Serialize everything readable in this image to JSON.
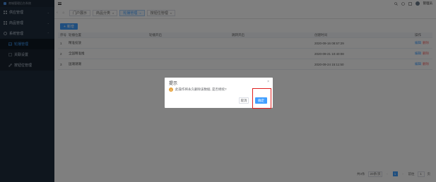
{
  "brand": {
    "name": "商城管理后台系统"
  },
  "sidebar": {
    "items": [
      {
        "label": "供应管理",
        "icon": "grid-icon"
      },
      {
        "label": "商品管理",
        "icon": "grid-icon"
      },
      {
        "label": "系统管理",
        "icon": "gear-icon"
      }
    ],
    "subitems": [
      {
        "label": "轮播管理",
        "icon": "image-icon"
      },
      {
        "label": "关联设置",
        "icon": "doc-icon"
      },
      {
        "label": "按钮位管理",
        "icon": "link-icon"
      }
    ]
  },
  "topbar": {
    "user": "管理员"
  },
  "tabs": {
    "items": [
      {
        "label": "门户展示"
      },
      {
        "label": "商品分类"
      },
      {
        "label": "轮播管理"
      },
      {
        "label": "按钮位管理"
      }
    ]
  },
  "toolbar": {
    "add_label": "新增"
  },
  "table": {
    "headers": [
      "序号",
      "轮播位置",
      "轮播开启",
      "跳转开启",
      "创建时间",
      "操作"
    ],
    "rows": [
      {
        "idx": "1",
        "name": "精准投放",
        "time": "2020-09-16 08:57:29"
      },
      {
        "idx": "2",
        "name": "全国精准推",
        "time": "2020-09-21 10:40:08"
      },
      {
        "idx": "3",
        "name": "国潮潮潮",
        "time": "2020-09-24 15:11:50"
      }
    ],
    "edit_label": "编辑",
    "delete_label": "删除"
  },
  "pagination": {
    "total": "共3条",
    "page_size": "20条/页",
    "current_page": "1",
    "goto_label": "前往",
    "goto_value": "1",
    "page_suffix": "页"
  },
  "dialog": {
    "title": "提示",
    "message": "此操作将永久删除该数据, 是否继续?",
    "cancel_label": "取消",
    "ok_label": "确定"
  },
  "colors": {
    "primary": "#409eff",
    "success": "#13ce66",
    "danger": "#f56c6c",
    "warning": "#e6a23c",
    "sidebar": "#1f2d3d"
  }
}
